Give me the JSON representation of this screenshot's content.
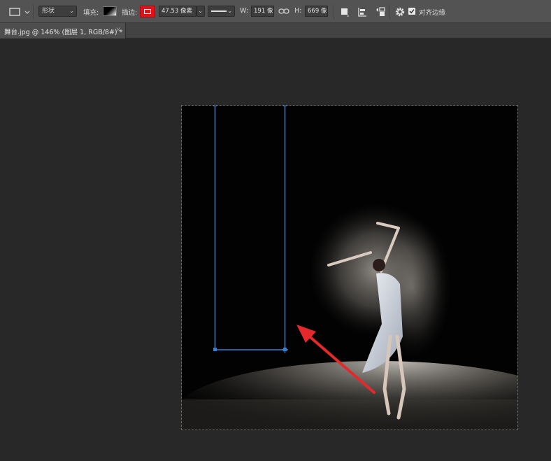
{
  "options_bar": {
    "tool_icon": "rectangle-tool-icon",
    "mode_value": "形状",
    "fill_label": "填充:",
    "stroke_label": "描边:",
    "stroke_color": "#e0131b",
    "stroke_width_value": "47.53 像素",
    "width_label": "W:",
    "width_value": "191 像",
    "link_icon": "link-icon",
    "height_label": "H:",
    "height_value": "669 像",
    "path_ops_icon": "path-operations-icon",
    "align_icon": "path-alignment-icon",
    "arrange_icon": "path-arrangement-icon",
    "gear_icon": "gear-icon",
    "align_edges_checked": true,
    "align_edges_label": "对齐边缘"
  },
  "document_tab": {
    "title": "舞台.jpg @ 146% (图层 1, RGB/8#) *",
    "close_label": "×"
  },
  "canvas": {
    "image_subject": "dancer-with-powder-cloud-photo",
    "selection_color": "#2f7ee0",
    "annotation_arrow_color": "#e5282b"
  }
}
